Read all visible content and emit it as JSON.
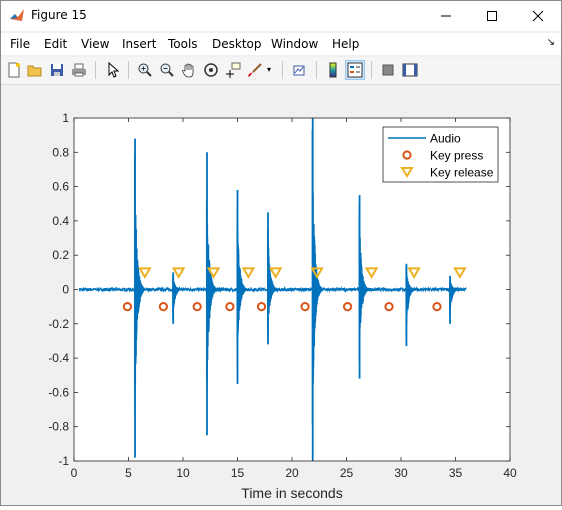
{
  "window": {
    "title": "Figure 15",
    "controls": {
      "minimize": "—",
      "maximize": "☐",
      "close": "✕"
    }
  },
  "menu": [
    "File",
    "Edit",
    "View",
    "Insert",
    "Tools",
    "Desktop",
    "Window",
    "Help"
  ],
  "toolbar": {
    "icons": [
      "new-figure-icon",
      "open-file-icon",
      "save-icon",
      "print-icon",
      "edit-plot-arrow-icon",
      "zoom-in-icon",
      "zoom-out-icon",
      "pan-hand-icon",
      "rotate-3d-icon",
      "data-cursor-icon",
      "brush-icon",
      "link-plot-icon",
      "colorbar-icon",
      "legend-icon",
      "hide-plot-tools-icon",
      "show-plot-tools-icon"
    ]
  },
  "colors": {
    "audio": "#0072BD",
    "key_press": "#D95319",
    "key_release": "#EDB120",
    "axes_text": "#262626",
    "axes_line": "#262626"
  },
  "chart_data": {
    "type": "line",
    "xlabel": "Time in seconds",
    "ylabel": "",
    "title": "",
    "xlim": [
      0,
      40
    ],
    "ylim": [
      -1,
      1
    ],
    "xticks": [
      0,
      5,
      10,
      15,
      20,
      25,
      30,
      35,
      40
    ],
    "yticks": [
      -1,
      -0.8,
      -0.6,
      -0.4,
      -0.2,
      0,
      0.2,
      0.4,
      0.6,
      0.8,
      1
    ],
    "ytick_labels": [
      "-1",
      "-0.8",
      "-0.6",
      "-0.4",
      "-0.2",
      "0",
      "0.2",
      "0.4",
      "0.6",
      "0.8",
      "1"
    ],
    "grid": false,
    "legend": {
      "location": "top-right",
      "entries": [
        "Audio",
        "Key press",
        "Key release"
      ]
    },
    "series": [
      {
        "name": "Audio",
        "kind": "line",
        "baseline_noise": 0.01,
        "bursts": [
          {
            "t": 5.6,
            "max": 0.88,
            "min": -0.98
          },
          {
            "t": 9.1,
            "max": 0.1,
            "min": -0.2
          },
          {
            "t": 12.2,
            "max": 0.8,
            "min": -0.85
          },
          {
            "t": 15.0,
            "max": 0.58,
            "min": -0.55
          },
          {
            "t": 17.8,
            "max": 0.45,
            "min": -0.32
          },
          {
            "t": 21.9,
            "max": 1.0,
            "min": -1.0
          },
          {
            "t": 26.2,
            "max": 0.55,
            "min": -0.52
          },
          {
            "t": 30.5,
            "max": 0.15,
            "min": -0.33
          },
          {
            "t": 34.5,
            "max": 0.08,
            "min": -0.2
          }
        ]
      },
      {
        "name": "Key press",
        "kind": "marker",
        "marker": "circle",
        "x": [
          4.9,
          8.2,
          11.3,
          14.3,
          17.2,
          21.2,
          25.1,
          28.9,
          33.3
        ],
        "y": [
          -0.1,
          -0.1,
          -0.1,
          -0.1,
          -0.1,
          -0.1,
          -0.1,
          -0.1,
          -0.1
        ]
      },
      {
        "name": "Key release",
        "kind": "marker",
        "marker": "triangle-down",
        "x": [
          6.5,
          9.6,
          12.8,
          16.0,
          18.5,
          22.3,
          27.3,
          31.2,
          35.4
        ],
        "y": [
          0.1,
          0.1,
          0.1,
          0.1,
          0.1,
          0.1,
          0.1,
          0.1,
          0.1
        ]
      }
    ]
  }
}
